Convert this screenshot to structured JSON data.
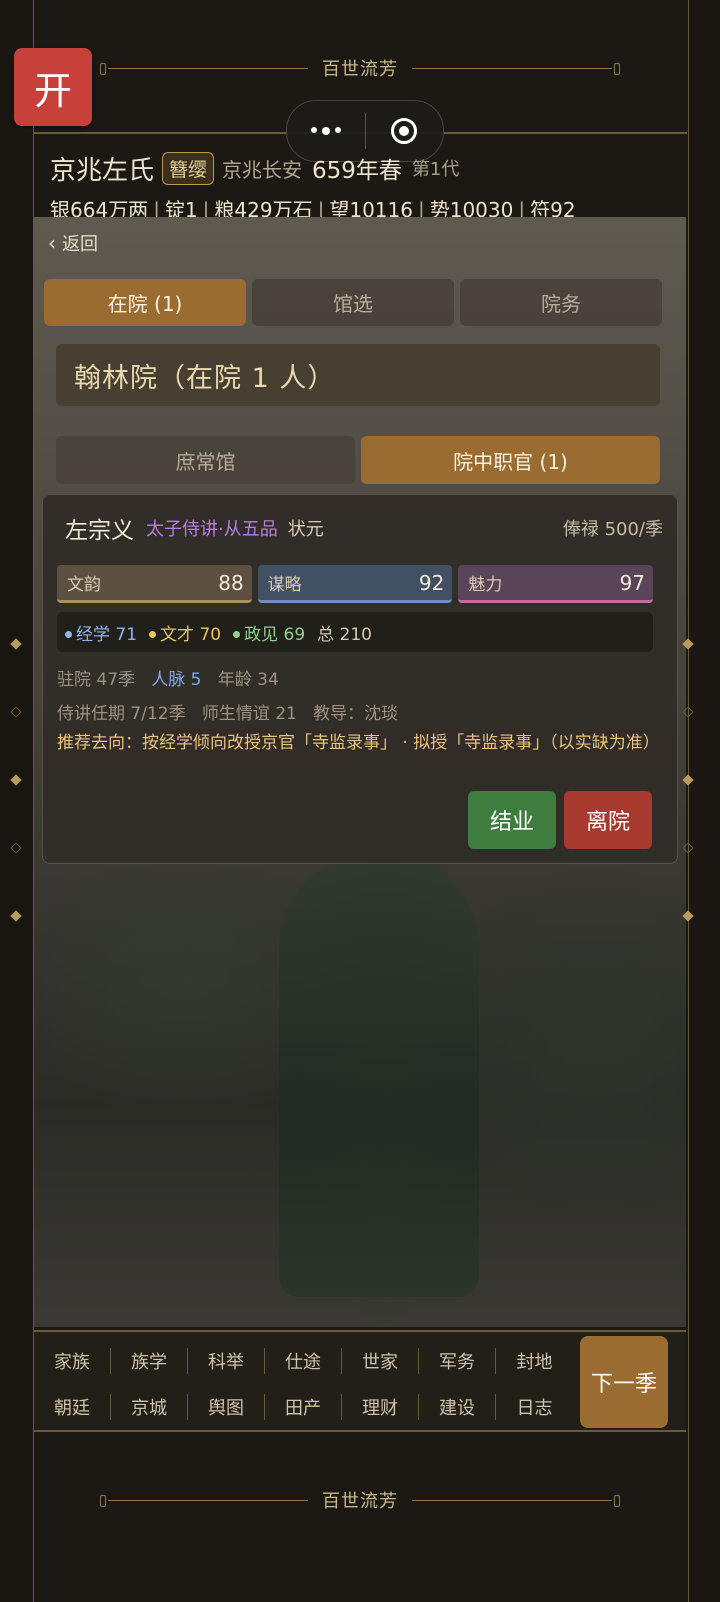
{
  "banner": {
    "top": "百世流芳",
    "bottom": "百世流芳"
  },
  "open_button": "开",
  "header": {
    "clan": "京兆左氏",
    "badge": "簪缨",
    "place": "京兆长安",
    "year": "659年春",
    "generation": "第1代",
    "resources": [
      "银664万两",
      "锭1",
      "粮429万石",
      "望10116",
      "势10030",
      "符92"
    ]
  },
  "back": "返回",
  "tabs": [
    "在院 (1)",
    "馆选",
    "院务"
  ],
  "institute_title": "翰林院（在院 1 人）",
  "subtabs": [
    "庶常馆",
    "院中职官 (1)"
  ],
  "person": {
    "name": "左宗义",
    "title": "太子侍讲·从五品",
    "honor": "状元",
    "salary": "俸禄 500/季",
    "stats": [
      {
        "label": "文韵",
        "value": "88"
      },
      {
        "label": "谋略",
        "value": "92"
      },
      {
        "label": "魅力",
        "value": "97"
      }
    ],
    "sub_stats": {
      "jingxue": "经学 71",
      "wencai": "文才 70",
      "zhengjian": "政见 69",
      "total": "总 210"
    },
    "info1": {
      "stay": "驻院 47季",
      "network": "人脉 5",
      "age": "年龄 34"
    },
    "info2": {
      "term": "侍讲任期 7/12季",
      "teacher": "师生情谊 21",
      "mentor": "教导：沈琰"
    },
    "recommend": "推荐去向：按经学倾向改授京官「寺监录事」 · 拟授「寺监录事」（以实缺为准）",
    "buttons": {
      "graduate": "结业",
      "leave": "离院"
    }
  },
  "nav": {
    "row1": [
      "家族",
      "族学",
      "科举",
      "仕途",
      "世家",
      "军务",
      "封地"
    ],
    "row2": [
      "朝廷",
      "京城",
      "舆图",
      "田产",
      "理财",
      "建设",
      "日志"
    ],
    "next": "下一季"
  },
  "colors": {
    "accent": "#9a6c32",
    "graduate": "#3f7d3f",
    "leave": "#a8392f",
    "open": "#c7403a"
  }
}
